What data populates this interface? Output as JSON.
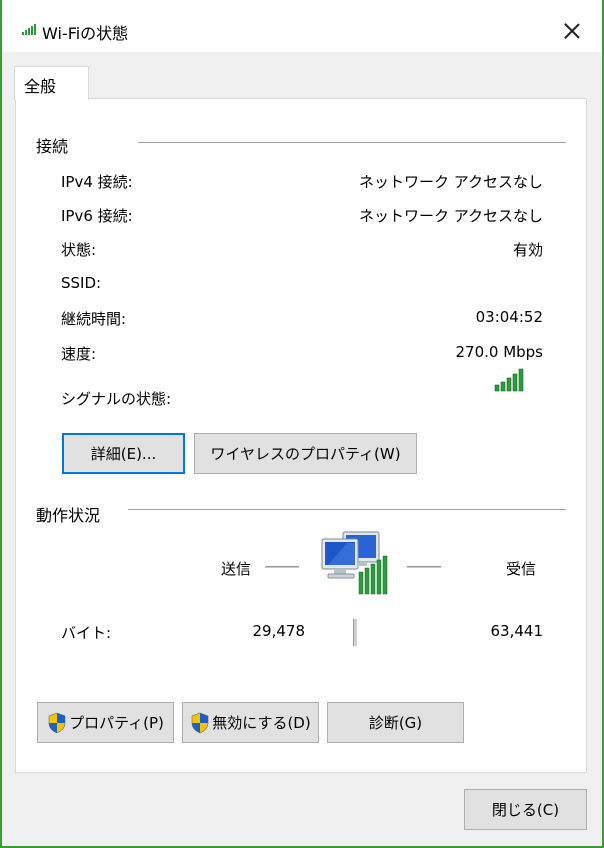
{
  "window": {
    "title": "Wi-Fiの状態",
    "close_icon": "close-icon"
  },
  "tabs": [
    {
      "label": "全般"
    }
  ],
  "connection": {
    "heading": "接続",
    "rows": [
      {
        "label": "IPv4 接続:",
        "value": "ネットワーク アクセスなし"
      },
      {
        "label": "IPv6 接続:",
        "value": "ネットワーク アクセスなし"
      },
      {
        "label": "状態:",
        "value": "有効"
      },
      {
        "label": "SSID:",
        "value": ""
      },
      {
        "label": "継続時間:",
        "value": "03:04:52"
      },
      {
        "label": "速度:",
        "value": "270.0 Mbps"
      }
    ],
    "signal_label": "シグナルの状態:",
    "signal_bars": 5,
    "details_button": "詳細(E)...",
    "wireless_props_button": "ワイヤレスのプロパティ(W)"
  },
  "activity": {
    "heading": "動作状況",
    "sent_label": "送信",
    "received_label": "受信",
    "bytes_label": "バイト:",
    "bytes_sent": "29,478",
    "bytes_received": "63,441"
  },
  "buttons": {
    "properties": "プロパティ(P)",
    "disable": "無効にする(D)",
    "diagnose": "診断(G)",
    "close": "閉じる(C)"
  },
  "colors": {
    "accent": "#0078d7",
    "signal": "#2e9a3e",
    "background": "#3a9d3a"
  }
}
